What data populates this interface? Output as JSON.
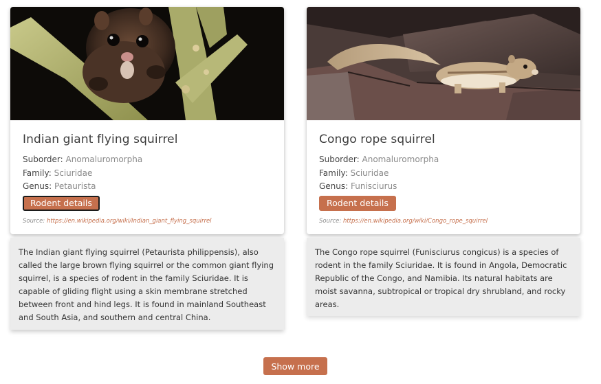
{
  "colors": {
    "accent": "#c6704d",
    "description_background": "#ececec"
  },
  "cards": [
    {
      "image_subject": "indian-giant-flying-squirrel-photo",
      "title": "Indian giant flying squirrel",
      "suborder_label": "Suborder:",
      "suborder_value": "Anomaluromorpha",
      "family_label": "Family:",
      "family_value": "Sciuridae",
      "genus_label": "Genus:",
      "genus_value": "Petaurista",
      "button_label": "Rodent details",
      "source_label": "Source:",
      "source_url": "https://en.wikipedia.org/wiki/Indian_giant_flying_squirrel",
      "description": "The Indian giant flying squirrel (Petaurista philippensis), also called the large brown flying squirrel or the common giant flying squirrel, is a species of rodent in the family Sciuridae. It is capable of gliding flight using a skin membrane stretched between front and hind legs. It is found in mainland Southeast and South Asia, and southern and central China."
    },
    {
      "image_subject": "congo-rope-squirrel-photo",
      "title": "Congo rope squirrel",
      "suborder_label": "Suborder:",
      "suborder_value": "Anomaluromorpha",
      "family_label": "Family:",
      "family_value": "Sciuridae",
      "genus_label": "Genus:",
      "genus_value": "Funisciurus",
      "button_label": "Rodent details",
      "source_label": "Source:",
      "source_url": "https://en.wikipedia.org/wiki/Congo_rope_squirrel",
      "description": "The Congo rope squirrel (Funisciurus congicus) is a species of rodent in the family Sciuridae. It is found in Angola, Democratic Republic of the Congo, and Namibia. Its natural habitats are moist savanna, subtropical or tropical dry shrubland, and rocky areas."
    }
  ],
  "show_more_label": "Show more"
}
